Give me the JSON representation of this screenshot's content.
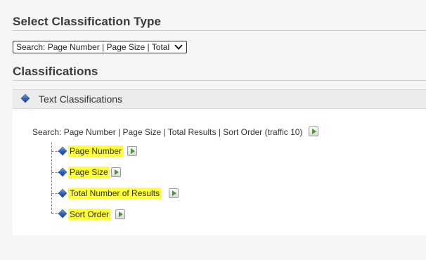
{
  "select_type": {
    "heading": "Select Classification Type",
    "selected_value": "Search: Page Number | Page Size | Total"
  },
  "classifications": {
    "heading": "Classifications",
    "panel_title": "Text Classifications",
    "root_label": "Search: Page Number | Page Size | Total Results | Sort Order (traffic 10)",
    "children": [
      {
        "label": "Page Number"
      },
      {
        "label": "Page Size"
      },
      {
        "label": "Total Number of Results"
      },
      {
        "label": "Sort Order"
      }
    ]
  },
  "colors": {
    "highlight": "#ffff33",
    "play_icon": "#3f9c2a",
    "diamond_icon": "#2a5db8"
  },
  "icons": {
    "select_chevron": "chevron-down-icon",
    "node": "blue-diamond-icon",
    "play": "play-icon"
  }
}
